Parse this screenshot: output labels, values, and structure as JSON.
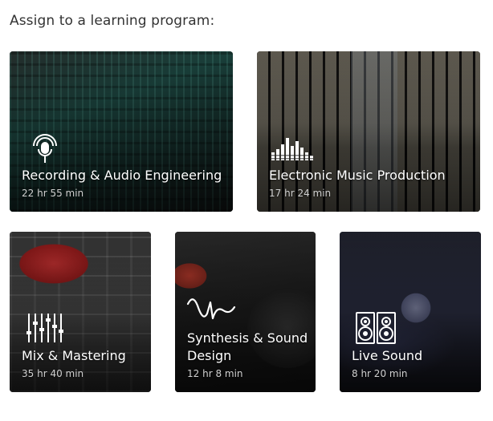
{
  "heading": "Assign to a learning program:",
  "programs": [
    {
      "title": "Recording & Audio Engineering",
      "duration": "22 hr 55 min",
      "icon": "microphone-icon"
    },
    {
      "title": "Electronic Music Production",
      "duration": "17 hr 24 min",
      "icon": "waveform-bars-icon"
    },
    {
      "title": "Mix & Mastering",
      "duration": "35 hr 40 min",
      "icon": "faders-icon"
    },
    {
      "title": "Synthesis & Sound Design",
      "duration": "12 hr 8 min",
      "icon": "waveform-icon"
    },
    {
      "title": "Live Sound",
      "duration": "8 hr 20 min",
      "icon": "speaker-icon"
    }
  ]
}
